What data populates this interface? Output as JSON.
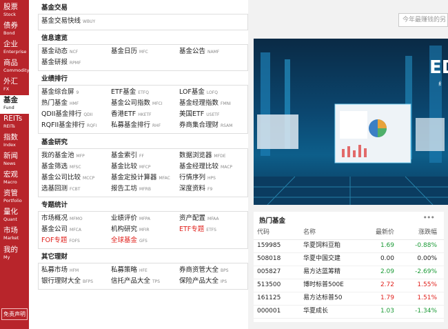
{
  "nav": [
    {
      "zh": "股票",
      "en": "Stock"
    },
    {
      "zh": "债券",
      "en": "Bond"
    },
    {
      "zh": "企业",
      "en": "Enterprise"
    },
    {
      "zh": "商品",
      "en": "Commodity"
    },
    {
      "zh": "外汇",
      "en": "FX"
    },
    {
      "zh": "基金",
      "en": "Fund"
    },
    {
      "zh": "REITs",
      "en": "REITs"
    },
    {
      "zh": "指数",
      "en": "Index"
    },
    {
      "zh": "新闻",
      "en": "News"
    },
    {
      "zh": "宏观",
      "en": "Macro"
    },
    {
      "zh": "资管",
      "en": "Portfolio"
    },
    {
      "zh": "量化",
      "en": "Quant"
    },
    {
      "zh": "市场",
      "en": "Market"
    },
    {
      "zh": "我的",
      "en": "My"
    }
  ],
  "disclaimer": "免责声明",
  "search_placeholder": "今年最赚钱的另",
  "sections": [
    {
      "title": "基金交易",
      "links": [
        {
          "zh": "基金交易快线",
          "code": "WBUY"
        }
      ]
    },
    {
      "title": "信息速览",
      "links": [
        {
          "zh": "基金动态",
          "code": "NCF"
        },
        {
          "zh": "基金日历",
          "code": "MFC"
        },
        {
          "zh": "基金公告",
          "code": "NAMF"
        },
        {
          "zh": "基金研报",
          "code": "RPMF"
        }
      ]
    },
    {
      "title": "业绩排行",
      "links": [
        {
          "zh": "基金综合屏",
          "code": "9"
        },
        {
          "zh": "ETF基金",
          "code": "ETFQ"
        },
        {
          "zh": "LOF基金",
          "code": "LOFQ"
        },
        {
          "zh": "热门基金",
          "code": "HMF"
        },
        {
          "zh": "基金公司指数",
          "code": "MFCI"
        },
        {
          "zh": "基金经理指数",
          "code": "FMNI"
        },
        {
          "zh": "QDII基金排行",
          "code": "QDII"
        },
        {
          "zh": "香港ETF",
          "code": "HKETF"
        },
        {
          "zh": "美国ETF",
          "code": "USETF"
        },
        {
          "zh": "RQFII基金排行",
          "code": "RQFI"
        },
        {
          "zh": "私募基金排行",
          "code": "RHF"
        },
        {
          "zh": "券商集合理财",
          "code": "RSAM"
        }
      ]
    },
    {
      "title": "基金研究",
      "links": [
        {
          "zh": "我的基金池",
          "code": "MFP"
        },
        {
          "zh": "基金索引",
          "code": "FF"
        },
        {
          "zh": "数据浏览器",
          "code": "MFDE"
        },
        {
          "zh": "基金筛选",
          "code": "MFSC"
        },
        {
          "zh": "基金比较",
          "code": "MFCP"
        },
        {
          "zh": "基金经理比较",
          "code": "MACP"
        },
        {
          "zh": "基金公司比较",
          "code": "MCCP"
        },
        {
          "zh": "基金定投计算器",
          "code": "MFAC"
        },
        {
          "zh": "行情序列",
          "code": "HPS"
        },
        {
          "zh": "选基回测",
          "code": "FCBT"
        },
        {
          "zh": "报告工坊",
          "code": "MFRB"
        },
        {
          "zh": "深度资料",
          "code": "F9"
        }
      ]
    },
    {
      "title": "专题统计",
      "links": [
        {
          "zh": "市场概况",
          "code": "MFMO"
        },
        {
          "zh": "业绩评价",
          "code": "MFPA"
        },
        {
          "zh": "资产配置",
          "code": "MFAA"
        },
        {
          "zh": "基金公司",
          "code": "MFCA"
        },
        {
          "zh": "机构研究",
          "code": "MFIR"
        },
        {
          "zh": "ETF专题",
          "code": "ETFS",
          "red": true
        },
        {
          "zh": "FOF专题",
          "code": "FOFS",
          "red": true
        },
        {
          "zh": "全球基金",
          "code": "GFS",
          "red": true
        }
      ]
    },
    {
      "title": "其它理财",
      "links": [
        {
          "zh": "私募市场",
          "code": "HFM"
        },
        {
          "zh": "私募策略",
          "code": "HFE"
        },
        {
          "zh": "券商资管大全",
          "code": "BPS"
        },
        {
          "zh": "银行理财大全",
          "code": "BFPS"
        },
        {
          "zh": "信托产品大全",
          "code": "TPS"
        },
        {
          "zh": "保险产品大全",
          "code": "IPS"
        }
      ]
    }
  ],
  "banner": {
    "partial_text": "ED",
    "sub_text": "纟"
  },
  "hot": {
    "title": "热门基金",
    "more": "•••",
    "headers": [
      "代码",
      "名称",
      "最新价",
      "涨跌幅"
    ],
    "rows": [
      {
        "code": "159985",
        "name": "华夏饲料豆粕",
        "price": "1.69",
        "chg": "-0.88%",
        "dir": "down"
      },
      {
        "code": "508018",
        "name": "华夏中国交建",
        "price": "0.00",
        "chg": "0.00%",
        "dir": "flat"
      },
      {
        "code": "005827",
        "name": "易方达蓝筹精",
        "price": "2.09",
        "chg": "-2.69%",
        "dir": "down"
      },
      {
        "code": "513500",
        "name": "博时标普500E",
        "price": "2.72",
        "chg": "1.55%",
        "dir": "up"
      },
      {
        "code": "161125",
        "name": "易方达标普50",
        "price": "1.79",
        "chg": "1.51%",
        "dir": "up"
      },
      {
        "code": "000001",
        "name": "华夏成长",
        "price": "1.03",
        "chg": "-1.34%",
        "dir": "down"
      }
    ]
  },
  "colors": {
    "nav_bg": "#b8252b",
    "up": "#e0201b",
    "down": "#1a9a35"
  }
}
